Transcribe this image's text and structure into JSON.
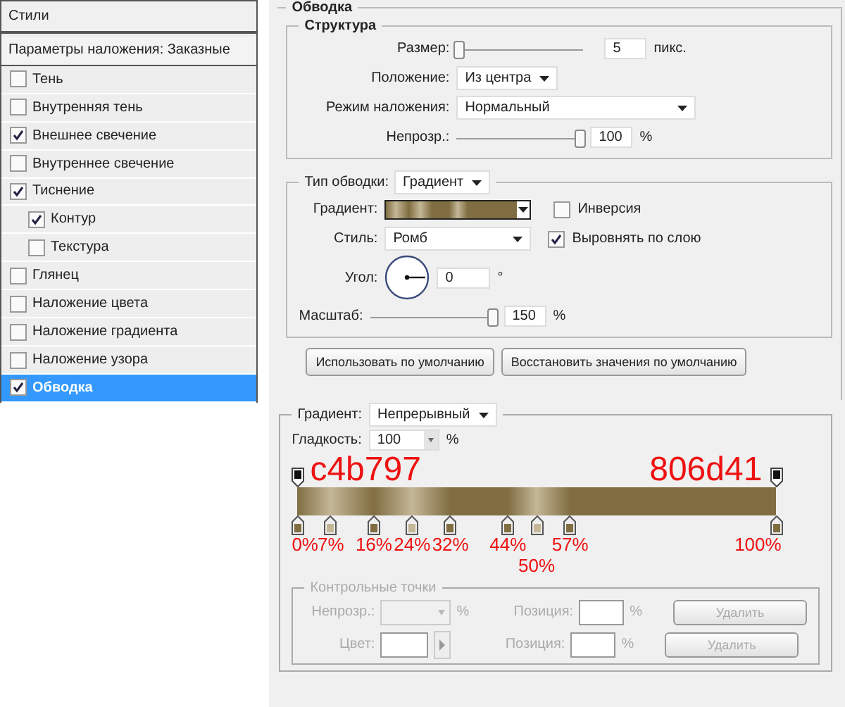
{
  "styles": {
    "header": "Стили",
    "blending": "Параметры наложения: Заказные",
    "items": [
      {
        "label": "Тень",
        "checked": false,
        "selected": false
      },
      {
        "label": "Внутренняя тень",
        "checked": false,
        "selected": false
      },
      {
        "label": "Внешнее свечение",
        "checked": true,
        "selected": false
      },
      {
        "label": "Внутреннее свечение",
        "checked": false,
        "selected": false
      },
      {
        "label": "Тиснение",
        "checked": true,
        "selected": false,
        "children": [
          {
            "label": "Контур",
            "checked": true,
            "selected": false
          },
          {
            "label": "Текстура",
            "checked": false,
            "selected": false
          }
        ]
      },
      {
        "label": "Глянец",
        "checked": false,
        "selected": false
      },
      {
        "label": "Наложение цвета",
        "checked": false,
        "selected": false
      },
      {
        "label": "Наложение градиента",
        "checked": false,
        "selected": false
      },
      {
        "label": "Наложение узора",
        "checked": false,
        "selected": false
      },
      {
        "label": "Обводка",
        "checked": true,
        "selected": true
      }
    ]
  },
  "stroke": {
    "title": "Обводка",
    "structure": {
      "title": "Структура",
      "size": {
        "label": "Размер:",
        "level": 0.02,
        "value": "5",
        "unit": "пикс."
      },
      "position": {
        "label": "Положение:",
        "value": "Из центра"
      },
      "blend_mode": {
        "label": "Режим наложения:",
        "value": "Нормальный"
      },
      "opacity": {
        "label": "Непрозр.:",
        "level": 0.98,
        "value": "100",
        "unit": "%"
      }
    },
    "fill_type": {
      "label": "Тип обводки:",
      "value": "Градиент"
    },
    "gradient": {
      "label": "Градиент:"
    },
    "reverse": {
      "label": "Инверсия",
      "checked": false
    },
    "style": {
      "label": "Стиль:",
      "value": "Ромб"
    },
    "align": {
      "label": "Выровнять по слою",
      "checked": true
    },
    "angle": {
      "label": "Угол:",
      "value": "0",
      "unit": "°"
    },
    "scale": {
      "label": "Масштаб:",
      "level": 0.97,
      "value": "150",
      "unit": "%"
    },
    "buttons": [
      "Использовать по умолчанию",
      "Восстановить значения по умолчанию"
    ]
  },
  "gradient_editor": {
    "type": {
      "label": "Градиент:",
      "value": "Непрерывный"
    },
    "smoothness": {
      "label": "Гладкость:",
      "value": "100",
      "unit": "%"
    },
    "opacity_stops": [
      {
        "level": 0,
        "note": "c4b797"
      },
      {
        "level": 1,
        "note": "806d41"
      }
    ],
    "color_stops": [
      {
        "level": 0,
        "color": "#806d41",
        "note": "0%"
      },
      {
        "level": 0.07,
        "color": "#c4b797",
        "note": "7%"
      },
      {
        "level": 0.16,
        "color": "#806d41",
        "note": "16%"
      },
      {
        "level": 0.24,
        "color": "#c4b797",
        "note": "24%"
      },
      {
        "level": 0.32,
        "color": "#806d41",
        "note": "32%"
      },
      {
        "level": 0.44,
        "color": "#806d41",
        "note": "44%"
      },
      {
        "level": 0.5,
        "color": "#c4b797",
        "note": "50%"
      },
      {
        "level": 0.57,
        "color": "#806d41",
        "note": "57%"
      },
      {
        "level": 1,
        "color": "#806d41",
        "note": "100%"
      }
    ],
    "control_points": {
      "title": "Контрольные точки",
      "disabled": true,
      "opacity": {
        "label": "Непрозр.:",
        "unit": "%"
      },
      "color": {
        "label": "Цвет:"
      },
      "position_1": {
        "label": "Позиция:",
        "unit": "%"
      },
      "position_2": {
        "label": "Позиция:",
        "unit": "%"
      },
      "buttons": [
        "Удалить",
        "Удалить"
      ]
    }
  }
}
